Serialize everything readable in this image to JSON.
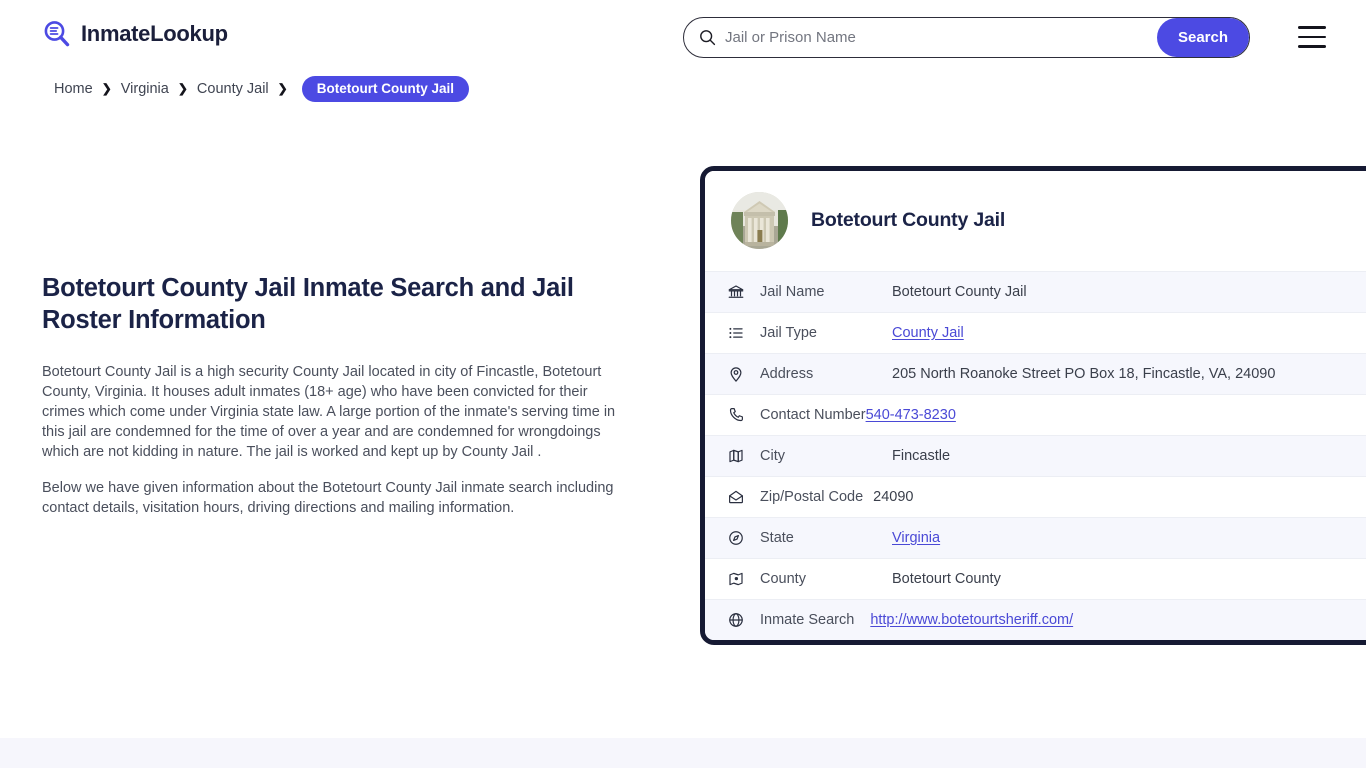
{
  "site": {
    "brand_name": "InmateLookup",
    "brand_icon": "search-list-logo-icon"
  },
  "search": {
    "placeholder": "Jail or Prison Name",
    "value": "",
    "button_label": "Search",
    "icon": "search-icon"
  },
  "menu": {
    "icon": "hamburger-menu-icon"
  },
  "breadcrumb": {
    "items": [
      {
        "label": "Home"
      },
      {
        "label": "Virginia"
      },
      {
        "label": "County Jail"
      }
    ],
    "separator": "❯",
    "current": "Botetourt County Jail"
  },
  "main": {
    "title": "Botetourt County Jail Inmate Search and Jail Roster Information",
    "paragraph_1": "Botetourt County Jail is a high security County Jail located in city of Fincastle, Botetourt County, Virginia. It houses adult inmates (18+ age) who have been convicted for their crimes which come under Virginia state law. A large portion of the inmate's serving time in this jail are condemned for the time of over a year and are condemned for wrongdoings which are not kidding in nature. The jail is worked and kept up by County Jail .",
    "paragraph_2": "Below we have given information about the Botetourt County Jail inmate search including contact details, visitation hours, driving directions and mailing information."
  },
  "card": {
    "thumbnail_icon": "courthouse-photo",
    "title": "Botetourt County Jail",
    "rows": [
      {
        "icon": "bank-building-icon",
        "label": "Jail Name",
        "value": "Botetourt County Jail",
        "link": false
      },
      {
        "icon": "list-icon",
        "label": "Jail Type",
        "value": "County Jail",
        "link": true
      },
      {
        "icon": "map-pin-icon",
        "label": "Address",
        "value": "205 North Roanoke Street PO Box 18, Fincastle, VA, 24090",
        "link": false
      },
      {
        "icon": "phone-icon",
        "label": "Contact Number",
        "value": "540-473-8230",
        "link": true
      },
      {
        "icon": "folded-map-icon",
        "label": "City",
        "value": "Fincastle",
        "link": false
      },
      {
        "icon": "envelope-icon",
        "label": "Zip/Postal Code",
        "value": "24090",
        "link": false
      },
      {
        "icon": "compass-globe-icon",
        "label": "State",
        "value": "Virginia",
        "link": true
      },
      {
        "icon": "map-location-icon",
        "label": "County",
        "value": "Botetourt County",
        "link": false
      },
      {
        "icon": "globe-icon",
        "label": "Inmate Search",
        "value": "http://www.botetourtsheriff.com/",
        "link": true
      }
    ]
  },
  "colors": {
    "accent": "#4c4ae3",
    "link": "#4a49d6",
    "heading": "#1b2347",
    "card_border": "#161a33",
    "row_alt": "#f6f7fd",
    "footer_strip": "#f6f6fc"
  }
}
